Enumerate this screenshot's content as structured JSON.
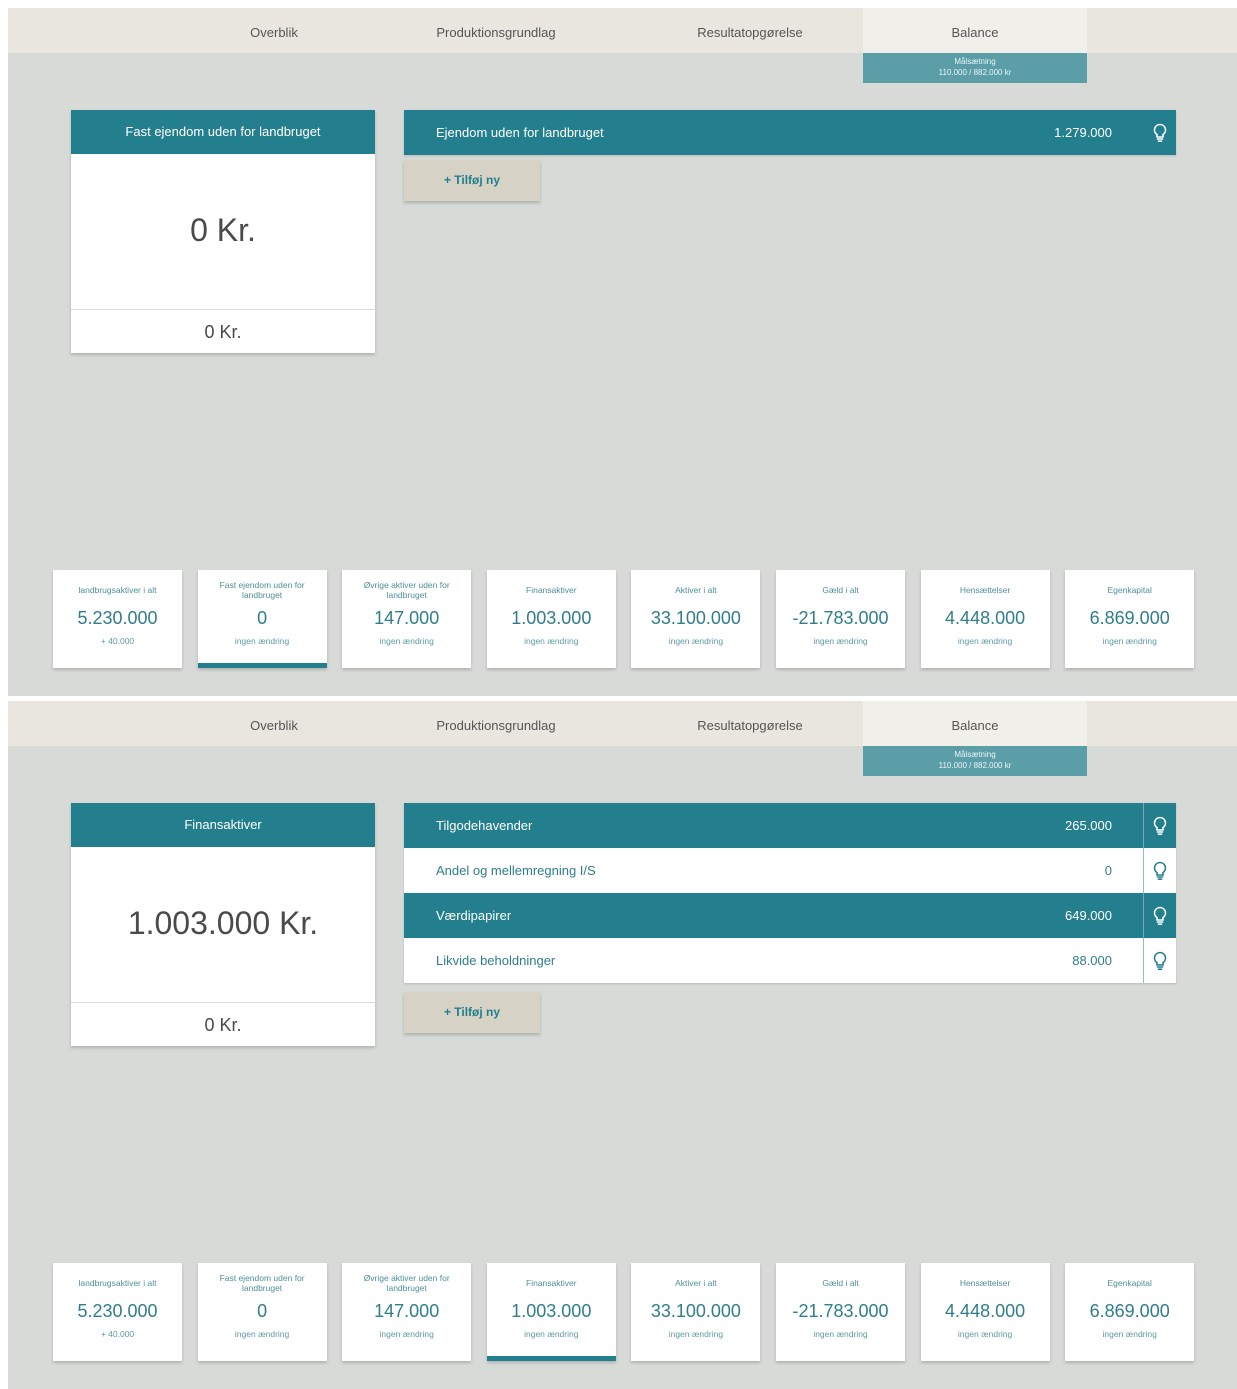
{
  "tabs": [
    "Overblik",
    "Produktionsgrundlag",
    "Resultatopgørelse",
    "Balance"
  ],
  "goal": {
    "title": "Målsætning",
    "value": "110.000 / 882.000 kr"
  },
  "add_button": "+ Tilføj ny",
  "colors": {
    "accent": "#237f8d",
    "background": "#d7dad7",
    "button": "#d6d3c6"
  },
  "panels": [
    {
      "summary": {
        "title": "Fast ejendom uden for landbruget",
        "value": "0 Kr.",
        "footer": "0 Kr."
      },
      "rows": [
        {
          "label": "Ejendom uden for landbruget",
          "amount": "1.279.000",
          "icon": "lightbulb-icon"
        }
      ],
      "active_kpi": 1
    },
    {
      "summary": {
        "title": "Finansaktiver",
        "value": "1.003.000 Kr.",
        "footer": "0 Kr."
      },
      "rows": [
        {
          "label": "Tilgodehavender",
          "amount": "265.000",
          "icon": "lightbulb-icon"
        },
        {
          "label": "Andel og mellemregning I/S",
          "amount": "0",
          "icon": "lightbulb-icon"
        },
        {
          "label": "Værdipapirer",
          "amount": "649.000",
          "icon": "lightbulb-icon"
        },
        {
          "label": "Likvide beholdninger",
          "amount": "88.000",
          "icon": "lightbulb-icon"
        }
      ],
      "active_kpi": 3
    }
  ],
  "kpis": [
    {
      "label": "landbrugsaktiver i alt",
      "value": "5.230.000",
      "change": "+ 40.000"
    },
    {
      "label": "Fast ejendom uden for landbruget",
      "value": "0",
      "change": "ingen ændring"
    },
    {
      "label": "Øvrige aktiver uden for landbruget",
      "value": "147.000",
      "change": "ingen ændring"
    },
    {
      "label": "Finansaktiver",
      "value": "1.003.000",
      "change": "ingen ændring"
    },
    {
      "label": "Aktiver i alt",
      "value": "33.100.000",
      "change": "ingen ændring"
    },
    {
      "label": "Gæld i alt",
      "value": "-21.783.000",
      "change": "ingen ændring"
    },
    {
      "label": "Hensættelser",
      "value": "4.448.000",
      "change": "ingen ændring"
    },
    {
      "label": "Egenkapital",
      "value": "6.869.000",
      "change": "ingen ændring"
    }
  ]
}
